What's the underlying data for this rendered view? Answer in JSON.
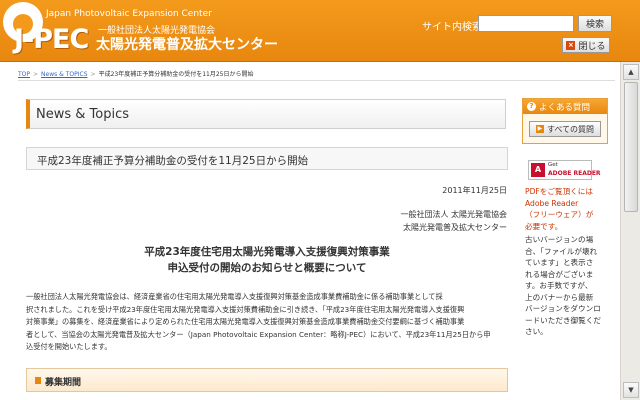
{
  "header": {
    "logo_text": "J-PEC",
    "logo_en": "Japan Photovoltaic Expansion Center",
    "org_type": "一般社団法人太陽光発電協会",
    "center_name": "太陽光発電普及拡大センター",
    "search_label": "サイト内検索",
    "search_placeholder": "",
    "search_button": "検索",
    "close_button": "閉じる"
  },
  "breadcrumb": {
    "items": [
      "TOP",
      "News & TOPICS",
      "平成23年度補正予算分補助金の受付を11月25日から開始"
    ]
  },
  "main": {
    "section_title": "News & Topics",
    "article_title": "平成23年度補正予算分補助金の受付を11月25日から開始",
    "date": "2011年11月25日",
    "org_line1": "一般社団法人 太陽光発電協会",
    "org_line2": "太陽光発電普及拡大センター",
    "heading_line1": "平成23年度住宅用太陽光発電導入支援復興対策事業",
    "heading_line2": "申込受付の開始のお知らせと概要について",
    "body_lines": [
      "一般社団法人太陽光発電協会は、経済産業省の住宅用太陽光発電導入支援復興対策基金造成事業費補助金に係る補助事業として採",
      "択されました。これを受け平成23年度住宅用太陽光発電導入支援対策費補助金に引き続き、「平成23年度住宅用太陽光発電導入支援復興",
      "対策事業」の募集を、経済産業省により定められた住宅用太陽光発電導入支援復興対策基金造成事業費補助金交付要綱に基づく補助事業",
      "者として、当協会の太陽光発電普及拡大センター（Japan Photovoltaic Expansion Center：略称J-PEC）において、平成23年11月25日から申",
      "込受付を開始いたします。"
    ],
    "sub_heading": "募集期間"
  },
  "sidebar": {
    "faq_title": "よくある質問",
    "faq_button": "すべての質問",
    "adobe_get": "Get",
    "adobe_reader": "ADOBE READER",
    "pdf_notice": [
      "PDFをご覧頂くには",
      "Adobe Reader",
      "（フリーウェア）が",
      "必要です。"
    ],
    "version_notice": [
      "古いバージョンの場",
      "合、「ファイルが壊れ",
      "ています」と表示さ",
      "れる場合がございま",
      "す。お手数ですが、",
      "上のバナーから最新",
      "バージョンをダウンロ",
      "ードいただき御覧くだ",
      "さい。"
    ]
  },
  "colors": {
    "header_orange": "#f39a1c",
    "accent_orange": "#e8870f",
    "link_blue": "#3366cc",
    "notice_red": "#cc3300"
  }
}
